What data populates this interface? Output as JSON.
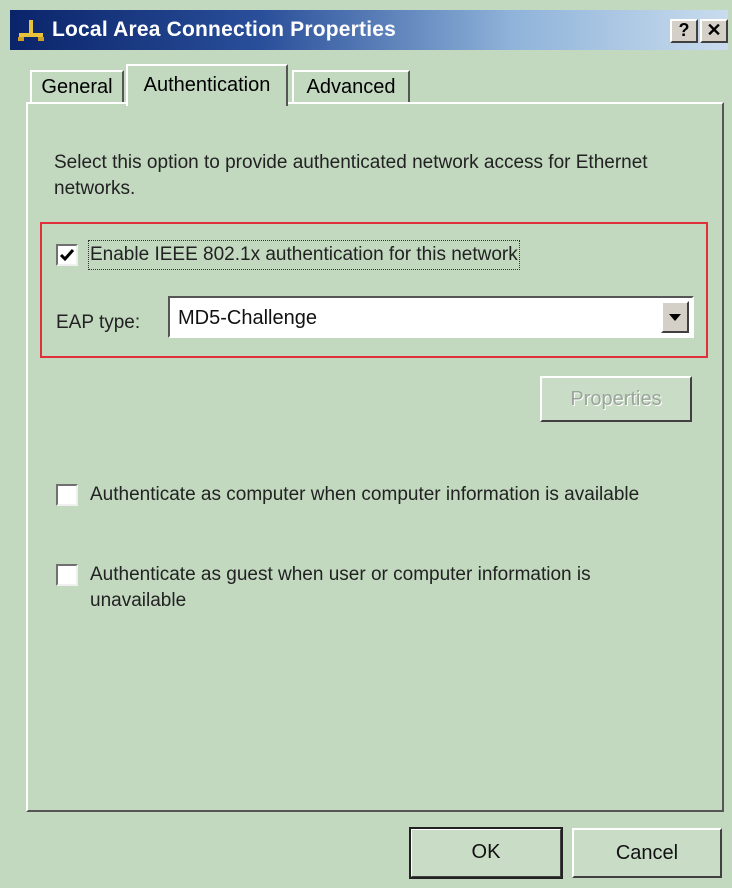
{
  "window": {
    "title": "Local Area Connection Properties",
    "help_button": "?",
    "close_button": "✕"
  },
  "tabs": [
    {
      "label": "General",
      "active": false
    },
    {
      "label": "Authentication",
      "active": true
    },
    {
      "label": "Advanced",
      "active": false
    }
  ],
  "authentication": {
    "description": "Select this option to provide authenticated network access for Ethernet networks.",
    "enable_8021x": {
      "label": "Enable IEEE 802.1x authentication for this network",
      "checked": true
    },
    "eap_type": {
      "label": "EAP type:",
      "value": "MD5-Challenge"
    },
    "properties_button": "Properties",
    "auth_as_computer": {
      "label": "Authenticate as computer when computer information is available",
      "checked": false
    },
    "auth_as_guest": {
      "label": "Authenticate as guest when user or computer information is unavailable",
      "checked": false
    }
  },
  "footer": {
    "ok_label": "OK",
    "cancel_label": "Cancel"
  },
  "colors": {
    "dialog_background": "#c2d9c0",
    "titlebar_start": "#0a246a",
    "highlight_box": "#e0303a"
  },
  "icons": [
    "network-connection-icon",
    "checkmark-icon",
    "dropdown-arrow-icon"
  ]
}
